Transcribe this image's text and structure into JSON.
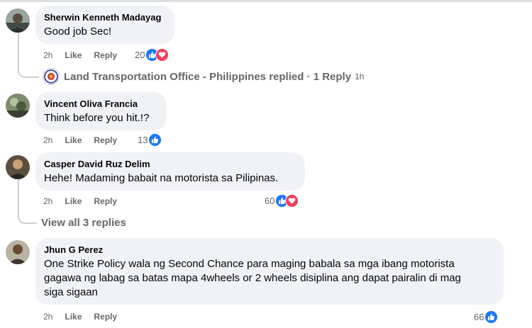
{
  "comments": [
    {
      "author": "Sherwin Kenneth Madayag",
      "text": "Good job Sec!",
      "time": "2h",
      "like_label": "Like",
      "reply_label": "Reply",
      "reaction_count": "20",
      "reactions": [
        "like-icon",
        "love-icon"
      ],
      "reply_preview": {
        "label": "Land Transportation Office - Philippines replied · 1 Reply",
        "time": "1h"
      }
    },
    {
      "author": "Vincent Oliva Francia",
      "text": "Think before you hit.!?",
      "time": "2h",
      "like_label": "Like",
      "reply_label": "Reply",
      "reaction_count": "13",
      "reactions": [
        "like-icon"
      ]
    },
    {
      "author": "Casper David Ruz Delim",
      "text": "Hehe! Madaming babait na motorista sa Pilipinas.",
      "time": "2h",
      "like_label": "Like",
      "reply_label": "Reply",
      "reaction_count": "60",
      "reactions": [
        "like-icon",
        "love-icon"
      ],
      "view_replies": "View all 3 replies"
    },
    {
      "author": "Jhun G Perez",
      "text_lines": [
        "One Strike Policy wala ng Second Chance para maging babala sa mga ibang motorista",
        "gagawa ng labag sa batas mapa 4wheels or 2 wheels disiplina ang dapat pairalin di mag",
        "siga sigaan"
      ],
      "time": "2h",
      "like_label": "Like",
      "reply_label": "Reply",
      "reaction_count": "66",
      "reactions": [
        "like-icon"
      ]
    }
  ],
  "colors": {
    "bubble": "#f0f2f5",
    "like_blue": "#1877f2",
    "love_red": "#f33e58",
    "meta_gray": "#65676b"
  }
}
